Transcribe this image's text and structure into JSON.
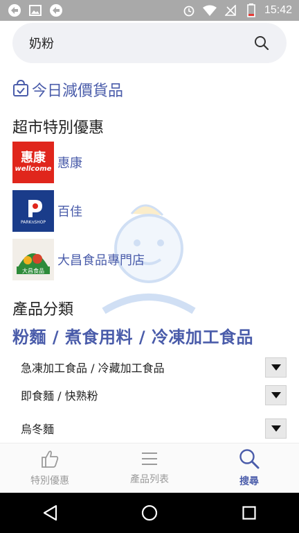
{
  "status_bar": {
    "time": "15:42"
  },
  "search": {
    "query": "奶粉"
  },
  "today_deals": {
    "label": "今日減價貨品"
  },
  "supermarket": {
    "title": "超市特別優惠",
    "stores": [
      {
        "name": "惠康",
        "logo_text_top": "惠康",
        "logo_text_bottom": "wellcome"
      },
      {
        "name": "百佳",
        "logo_text": "PARKnSHOP"
      },
      {
        "name": "大昌食品專門店",
        "logo_text": "大昌食品"
      }
    ]
  },
  "categories": {
    "title": "產品分類",
    "selected": "粉麵 / 煮食用料 / 冷凍加工食品",
    "subcategories": [
      {
        "label": "急凍加工食品 / 冷藏加工食品"
      },
      {
        "label": "即食麵 / 快熟粉"
      },
      {
        "label": "烏冬麵"
      }
    ]
  },
  "tabbar": {
    "tabs": [
      {
        "label": "特別優惠",
        "icon": "thumbs-up-icon"
      },
      {
        "label": "產品列表",
        "icon": "list-icon"
      },
      {
        "label": "搜尋",
        "icon": "search-icon"
      }
    ],
    "active_index": 2
  },
  "colors": {
    "accent": "#4a5caa",
    "status_bar": "#a9a9a9",
    "tab_inactive": "#9a9a9a"
  }
}
